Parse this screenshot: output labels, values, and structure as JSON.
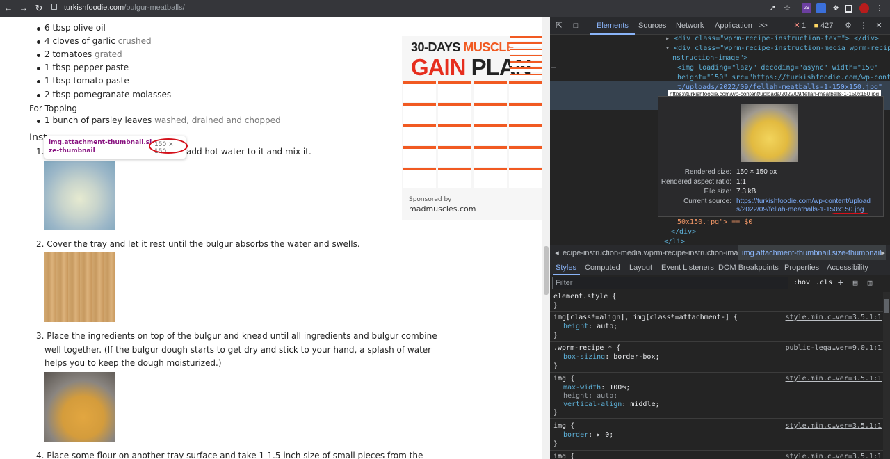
{
  "browser": {
    "url_host": "turkishfoodie.com",
    "url_path": "/bulgur-meatballs/",
    "ext_badge": "29"
  },
  "page": {
    "sauce_items": [
      {
        "main": "6 tbsp olive oil",
        "note": ""
      },
      {
        "main": "4 cloves of garlic",
        "note": " crushed"
      },
      {
        "main": "2 tomatoes",
        "note": " grated"
      },
      {
        "main": "1 tbsp pepper paste",
        "note": ""
      },
      {
        "main": "1 tbsp tomato paste",
        "note": ""
      },
      {
        "main": "2 tbsp pomegranate molasses",
        "note": ""
      }
    ],
    "topping_heading": "For Topping",
    "topping_items": [
      {
        "main": "1 bunch of parsley leaves",
        "note": " washed, drained and chopped"
      }
    ],
    "instructions_heading": "Inst",
    "step1_num": "1.",
    "step1_tail": "add hot water to it and mix it.",
    "step2": "2. Cover the tray and let it rest until the bulgur absorbs the water and swells.",
    "step3_lines": [
      "3. Place the ingredients on top of the bulgur and knead until all ingredients and bulgur combine",
      "well together. (If the bulgur dough starts to get dry and stick to your hand, a splash of water",
      "helps you to keep the dough moisturized.)"
    ],
    "step4": "4. Place some flour on another tray surface and take 1-1.5 inch size of small pieces from the",
    "tooltip_selector": "img.attachment-thumbnail.size-thumbnail",
    "tooltip_dims": "150 × 150"
  },
  "ad": {
    "line1_a": "30-DAYS ",
    "line1_b": "MUSCLE",
    "line2_a": "GAIN ",
    "line2_b": "PLAN",
    "sponsored": "Sponsored by",
    "domain": "madmuscles.com"
  },
  "devtools": {
    "tabs": [
      "Elements",
      "Sources",
      "Network",
      "Application"
    ],
    "more": ">>",
    "errors": "1",
    "warnings": "427",
    "html_lines": [
      "<div class=\"wprm-recipe-instruction-text\"> </div>",
      "<div class=\"wprm-recipe-instruction-media wprm-recipe-i",
      "nstruction-image\">",
      "<img loading=\"lazy\" decoding=\"async\" width=\"150\"",
      "height=\"150\" src=\"https://turkishfoodie.com/wp-conten",
      "t/uploads/2022/09/fellah-meatballs-1-150x150.jpg\"",
      "50x150.jpg\"> == $0",
      "</div>",
      "</li>"
    ],
    "hover_url_a": "https://turkishfoodie.com/wp-content/uploads/2022/09/fellah-meatballs-1-",
    "hover_url_b": "150x150",
    "hover_url_c": ".jpg",
    "popover": {
      "rendered_label": "Rendered size:",
      "rendered_value": "150 × 150 px",
      "aspect_label": "Rendered aspect ratio:",
      "aspect_value": "1:1",
      "filesize_label": "File size:",
      "filesize_value": "7.3 kB",
      "source_label": "Current source:",
      "source_a": "https://turkishfoodie.com/wp-content/uploads/2022/09/fellah-meatballs-1-",
      "source_b": "150x150",
      "source_c": ".jpg"
    },
    "breadcrumb_1": "ecipe-instruction-media.wprm-recipe-instruction-image",
    "breadcrumb_2": "img.attachment-thumbnail.size-thumbnail",
    "sub_tabs": [
      "Styles",
      "Computed",
      "Layout",
      "Event Listeners",
      "DOM Breakpoints",
      "Properties",
      "Accessibility"
    ],
    "filter_placeholder": "Filter",
    "hov": ":hov",
    "cls": ".cls",
    "rules": {
      "r1_sel": "element.style {",
      "r2_sel": "img[class*=align], img[class*=attachment-] {",
      "r2_src": "style.min.c…ver=3.5.1:1",
      "r2_prop": "height",
      "r2_val": "auto;",
      "r3_sel": ".wprm-recipe * {",
      "r3_src": "public-lega…ver=9.0.1:1",
      "r3_prop": "box-sizing",
      "r3_val": "border-box;",
      "r4_sel": "img {",
      "r4_src": "style.min.c…ver=3.5.1:1",
      "r4_p1": "max-width",
      "r4_v1": "100%;",
      "r4_p2": "height: auto;",
      "r4_p3": "vertical-align",
      "r4_v3": "middle;",
      "r5_sel": "img {",
      "r5_src": "style.min.c…ver=3.5.1:1",
      "r5_prop": "border",
      "r5_val": "0;",
      "r6_sel": "img {",
      "r6_src": "style.min.c…ver=3.5.1:1",
      "close": "}"
    }
  }
}
